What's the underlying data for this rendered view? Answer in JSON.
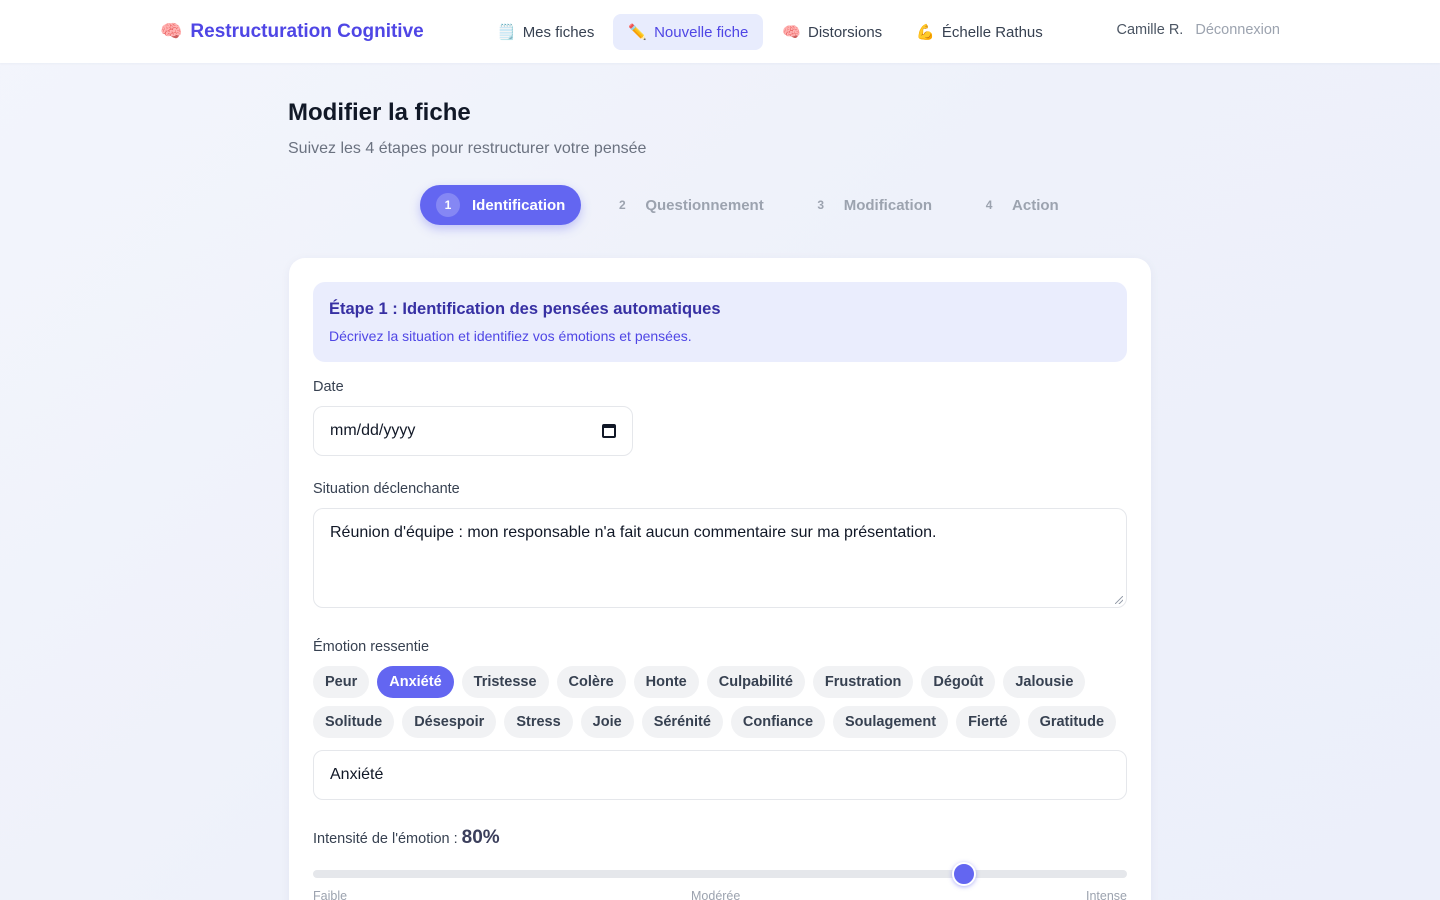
{
  "header": {
    "brand": {
      "icon": "brain",
      "icon_glyph": "🧠",
      "label": "Restructuration Cognitive"
    },
    "nav": [
      {
        "icon": "notepad",
        "icon_glyph": "🗒️",
        "label": "Mes fiches",
        "active": false
      },
      {
        "icon": "pencil",
        "icon_glyph": "✏️",
        "label": "Nouvelle fiche",
        "active": true
      },
      {
        "icon": "brain",
        "icon_glyph": "🧠",
        "label": "Distorsions",
        "active": false
      },
      {
        "icon": "flexed-biceps",
        "icon_glyph": "💪",
        "label": "Échelle Rathus",
        "active": false
      }
    ],
    "user_name": "Camille R.",
    "logout_label": "Déconnexion"
  },
  "page": {
    "title": "Modifier la fiche",
    "subtitle": "Suivez les 4 étapes pour restructurer votre pensée"
  },
  "steps": [
    {
      "number": "1",
      "label": "Identification",
      "active": true
    },
    {
      "number": "2",
      "label": "Questionnement",
      "active": false
    },
    {
      "number": "3",
      "label": "Modification",
      "active": false
    },
    {
      "number": "4",
      "label": "Action",
      "active": false
    }
  ],
  "form": {
    "info_title": "Étape 1 : Identification des pensées automatiques",
    "info_desc": "Décrivez la situation et identifiez vos émotions et pensées.",
    "date_label": "Date",
    "date_placeholder": "mm/dd/yyyy",
    "situation_label": "Situation déclenchante",
    "situation_value": "Réunion d'équipe : mon responsable n'a fait aucun commentaire sur ma présentation.",
    "emotion_label": "Émotion ressentie",
    "emotion_chips_row1": [
      "Peur",
      "Anxiété",
      "Tristesse",
      "Colère",
      "Honte",
      "Culpabilité",
      "Frustration",
      "Dégoût",
      "Jalousie"
    ],
    "emotion_chips_row2": [
      "Solitude",
      "Désespoir",
      "Stress",
      "Joie",
      "Sérénité",
      "Confiance",
      "Soulagement",
      "Fierté",
      "Gratitude"
    ],
    "selected_emotion": "Anxiété",
    "emotion_value": "Anxiété",
    "intensity_label": "Intensité de l'émotion :",
    "intensity_value": "80%",
    "intensity_percent": 80,
    "scale": [
      "Faible",
      "Modérée",
      "Intense"
    ]
  },
  "colors": {
    "accent": "#6366f1",
    "brand": "#4f46e5"
  }
}
